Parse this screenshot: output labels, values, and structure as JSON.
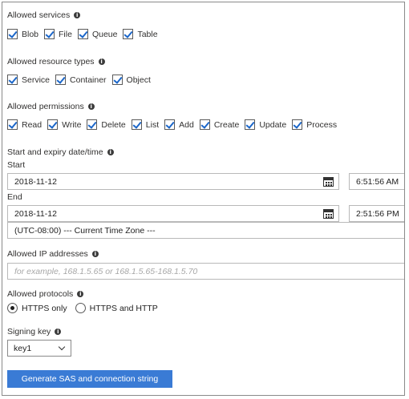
{
  "services": {
    "label": "Allowed services",
    "items": [
      "Blob",
      "File",
      "Queue",
      "Table"
    ]
  },
  "resource_types": {
    "label": "Allowed resource types",
    "items": [
      "Service",
      "Container",
      "Object"
    ]
  },
  "permissions": {
    "label": "Allowed permissions",
    "items": [
      "Read",
      "Write",
      "Delete",
      "List",
      "Add",
      "Create",
      "Update",
      "Process"
    ]
  },
  "dates": {
    "label": "Start and expiry date/time",
    "start_label": "Start",
    "start_date": "2018-11-12",
    "start_time": "6:51:56 AM",
    "end_label": "End",
    "end_date": "2018-11-12",
    "end_time": "2:51:56 PM",
    "timezone": "(UTC-08:00) --- Current Time Zone ---"
  },
  "ip": {
    "label": "Allowed IP addresses",
    "placeholder": "for example, 168.1.5.65 or 168.1.5.65-168.1.5.70"
  },
  "protocols": {
    "label": "Allowed protocols",
    "options": [
      "HTTPS only",
      "HTTPS and HTTP"
    ],
    "selected": "HTTPS only"
  },
  "signing": {
    "label": "Signing key",
    "value": "key1"
  },
  "generate_button": "Generate SAS and connection string",
  "colors": {
    "accent": "#3a7bd5",
    "check": "#1b66c9"
  }
}
